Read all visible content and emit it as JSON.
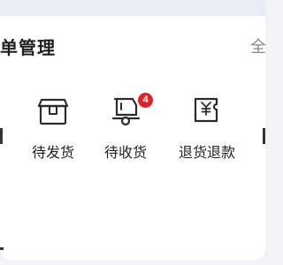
{
  "order_card": {
    "title": "单管理",
    "more_label": "全",
    "items": [
      {
        "label": "待发货",
        "icon": "package-icon",
        "badge": null
      },
      {
        "label": "待收货",
        "icon": "delivery-truck-icon",
        "badge": "4"
      },
      {
        "label": "退货退款",
        "icon": "refund-ticket-icon",
        "badge": null
      }
    ]
  },
  "colors": {
    "icon_stroke": "#2b2b2b",
    "badge_bg": "#d9262c",
    "card_bg": "#ffffff",
    "page_bg": "#f2f3f7",
    "top_strip": "#e9edf6"
  }
}
